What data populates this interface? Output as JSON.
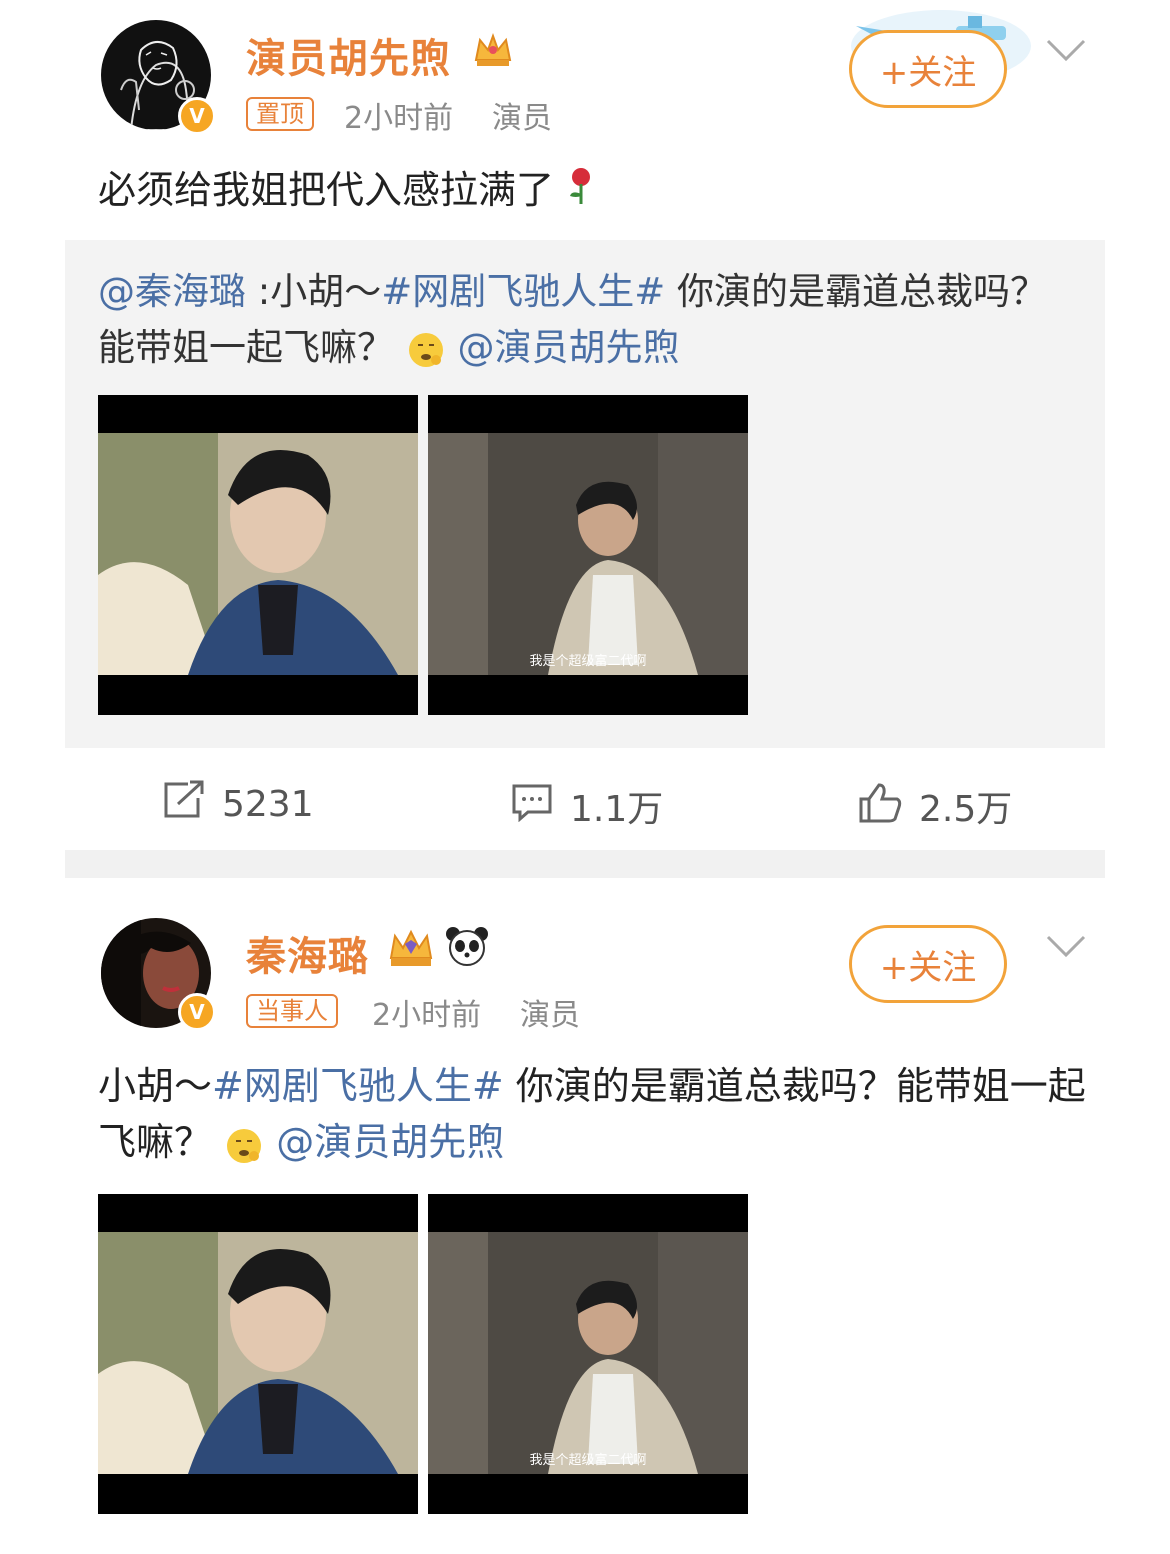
{
  "post1": {
    "username": "演员胡先煦",
    "tag": "置顶",
    "time": "2小时前",
    "source": "演员",
    "follow_label": "+关注",
    "text": "必须给我姐把代入感拉满了",
    "quote": {
      "mention": "@秦海璐",
      "sep": " :小胡～",
      "hashtag": "#网剧飞驰人生#",
      "body1": " 你演的是霸道总裁吗？能带姐一起飞嘛？",
      "mention2": "@演员胡先煦",
      "subtitle": "我是个超级富二代啊"
    },
    "actions": {
      "repost": "5231",
      "comment": "1.1万",
      "like": "2.5万"
    }
  },
  "post2": {
    "username": "秦海璐",
    "tag": "当事人",
    "time": "2小时前",
    "source": "演员",
    "follow_label": "+关注",
    "text_pre": "小胡～",
    "hashtag": "#网剧飞驰人生#",
    "text_body": " 你演的是霸道总裁吗？能带姐一起飞嘛？",
    "mention": "@演员胡先煦",
    "subtitle": "我是个超级富二代啊"
  },
  "colors": {
    "accent": "#e8823a",
    "link": "#4a6fa5",
    "quote_bg": "#f3f3f3",
    "meta": "#8a8a8a"
  }
}
